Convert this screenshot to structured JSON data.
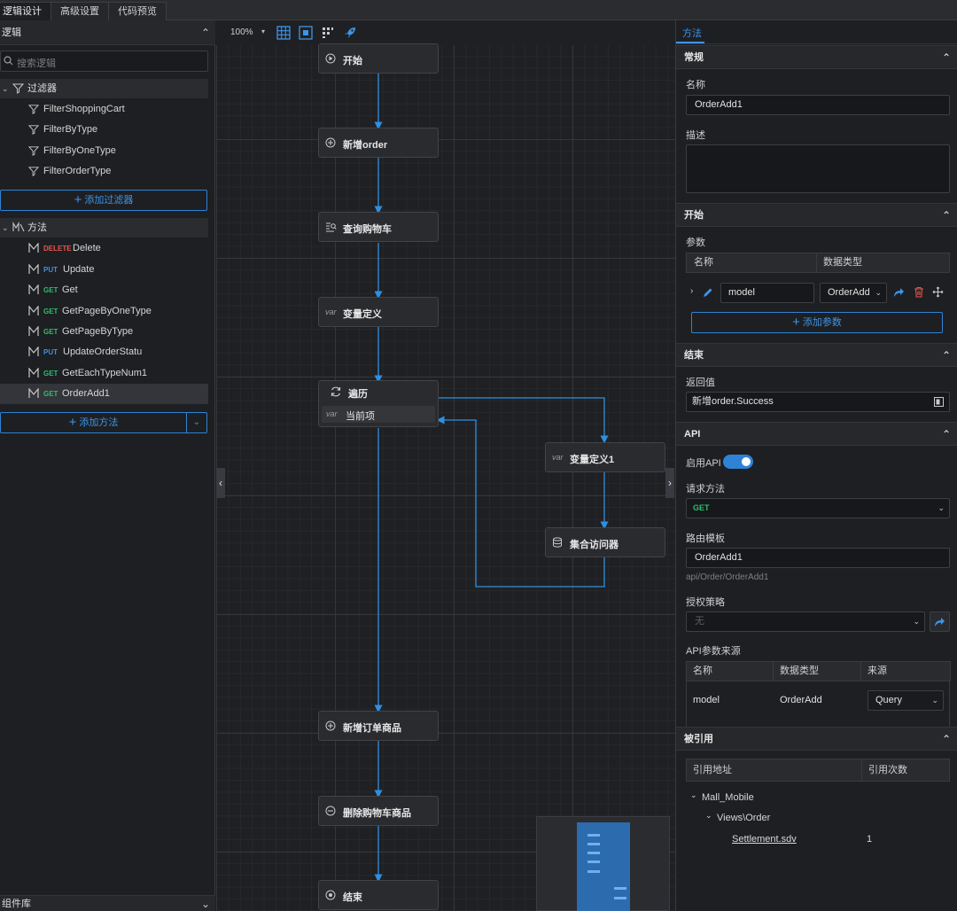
{
  "top_tabs": [
    {
      "label": "逻辑设计"
    },
    {
      "label": "高级设置"
    },
    {
      "label": "代码预览"
    }
  ],
  "left": {
    "header": "逻辑",
    "search_placeholder": "搜索逻辑",
    "filters": {
      "label": "过滤器",
      "items": [
        "FilterShoppingCart",
        "FilterByType",
        "FilterByOneType",
        "FilterOrderType"
      ],
      "add_label": "添加过滤器"
    },
    "methods": {
      "label": "方法",
      "items": [
        {
          "method": "DELETE",
          "name": "Delete"
        },
        {
          "method": "PUT",
          "name": "Update"
        },
        {
          "method": "GET",
          "name": "Get"
        },
        {
          "method": "GET",
          "name": "GetPageByOneType"
        },
        {
          "method": "GET",
          "name": "GetPageByType"
        },
        {
          "method": "PUT",
          "name": "UpdateOrderStatu"
        },
        {
          "method": "GET",
          "name": "GetEachTypeNum1"
        },
        {
          "method": "GET",
          "name": "OrderAdd1"
        }
      ],
      "selected": "OrderAdd1",
      "add_label": "添加方法"
    },
    "component_library": "组件库"
  },
  "canvas": {
    "zoom": "100%",
    "nodes": {
      "start": "开始",
      "add_order": "新增order",
      "query_cart": "查询购物车",
      "var_def": "变量定义",
      "loop": "遍历",
      "current_item": "当前项",
      "var_def1": "变量定义1",
      "collection_accessor": "集合访问器",
      "add_order_item": "新增订单商品",
      "delete_cart_item": "删除购物车商品",
      "end": "结束"
    },
    "var_icon": "var"
  },
  "right": {
    "tab": "方法",
    "general": {
      "title": "常规",
      "name_label": "名称",
      "name_value": "OrderAdd1",
      "desc_label": "描述"
    },
    "start": {
      "title": "开始",
      "params_label": "参数",
      "col_name": "名称",
      "col_type": "数据类型",
      "param_name": "model",
      "param_type": "OrderAdd",
      "add_param": "添加参数"
    },
    "end": {
      "title": "结束",
      "return_label": "返回值",
      "return_value": "新增order.Success"
    },
    "api": {
      "title": "API",
      "enable_label": "启用API",
      "enabled": true,
      "method_label": "请求方法",
      "method_value": "GET",
      "route_label": "路由模板",
      "route_value": "OrderAdd1",
      "route_hint": "api/Order/OrderAdd1",
      "auth_label": "授权策略",
      "auth_placeholder": "无",
      "source_label": "API参数来源",
      "source_cols": [
        "名称",
        "数据类型",
        "来源"
      ],
      "source_row": {
        "name": "model",
        "type": "OrderAdd",
        "source": "Query"
      }
    },
    "refs": {
      "title": "被引用",
      "cols": [
        "引用地址",
        "引用次数"
      ],
      "tree": {
        "root": "Mall_Mobile",
        "child": "Views\\Order",
        "leaf": "Settlement.sdv",
        "leaf_count": "1"
      }
    }
  },
  "colors": {
    "accent": "#3c95e8",
    "get": "#2dbd6e",
    "put": "#3e8fe0",
    "delete": "#e5574f",
    "connector": "#2f8fe0"
  }
}
